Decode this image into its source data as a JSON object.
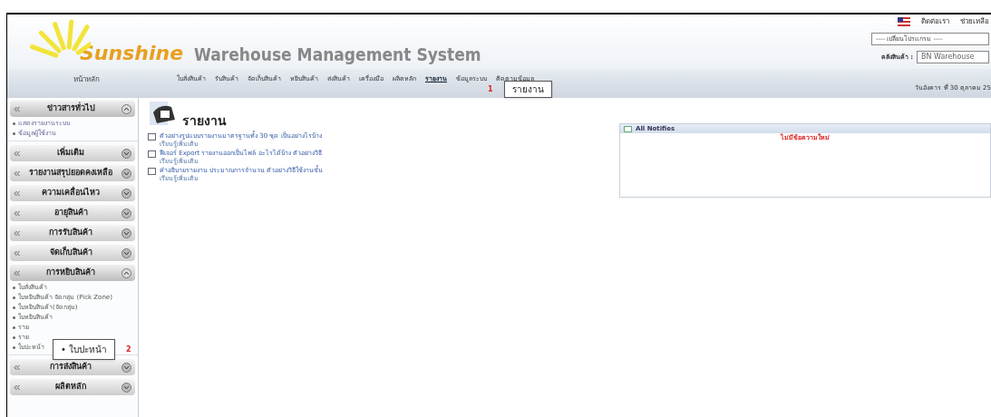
{
  "header": {
    "brand": "Sunshine",
    "title": "Warehouse Management System",
    "links": [
      "ติดต่อเรา",
      "ช่วยเหลือ"
    ],
    "program_select": "---- เปลี่ยนโปรแกรม ----",
    "warehouse_label": "คลังสินค้า :",
    "warehouse_select": "BN Warehouse"
  },
  "nav": {
    "home": "หน้าหลัก",
    "items": [
      {
        "label": "ใบสั่งสินค้า",
        "selected": false
      },
      {
        "label": "รับสินค้า",
        "selected": false
      },
      {
        "label": "จัดเก็บสินค้า",
        "selected": false
      },
      {
        "label": "หยิบสินค้า",
        "selected": false
      },
      {
        "label": "ส่งสินค้า",
        "selected": false
      },
      {
        "label": "เครื่องมือ",
        "selected": false
      },
      {
        "label": "ผลิตหลัก",
        "selected": false
      },
      {
        "label": "รายงาน",
        "selected": true
      },
      {
        "label": "ข้อมูลระบบ",
        "selected": false
      },
      {
        "label": "ติดตามข้อมูล",
        "selected": false
      }
    ],
    "date": "วันอังคาร ที่ 30 ตุลาคม 25"
  },
  "sidebar": {
    "sections": [
      {
        "title": "ข่าวสารทั่วไป",
        "expanded": true,
        "items": [
          "แสดงรายงานระบบ",
          "ข้อมูลผู้ใช้งาน"
        ]
      },
      {
        "title": "เพิ่มเติม",
        "expanded": false
      },
      {
        "title": "รายงานสรุปยอดคงเหลือ",
        "expanded": false
      },
      {
        "title": "ความเคลื่อนไหว",
        "expanded": false
      },
      {
        "title": "อายุสินค้า",
        "expanded": false
      },
      {
        "title": "การรับสินค้า",
        "expanded": false
      },
      {
        "title": "จัดเก็บสินค้า",
        "expanded": false
      },
      {
        "title": "การหยิบสินค้า",
        "expanded": true,
        "items": [
          "ใบสั่งสินค้า",
          "ใบหยิบสินค้า จัดกลุ่ม (Pick Zone)",
          "ใบหยิบสินค้า(จัดกลุ่ม)",
          "ใบหยิบสินค้า",
          "ราย",
          "ราย",
          "ใบปะหน้า"
        ]
      },
      {
        "title": "การส่งสินค้า",
        "expanded": false
      },
      {
        "title": "ผลิตหลัก",
        "expanded": false
      }
    ]
  },
  "page": {
    "title": "รายงาน",
    "links": [
      {
        "text": "ตัวอย่างรูปแบบรายงานมาตรฐานทั้ง 30 ชุด เป็นอย่างไรบ้าง",
        "more": "เรียนรู้เพิ่มเติม"
      },
      {
        "text": "ฟีเจอร์ Export รายงานออกเป็นไฟล์ อะไรได้บ้าง ตัวอย่างวิธี",
        "more": "เรียนรู้เพิ่มเติม"
      },
      {
        "text": "คำอธิบายรายงาน ประมาณการจำนวน ตัวอย่างวิธีใช้งานขั้น",
        "more": "เรียนรู้เพิ่มเติม"
      }
    ]
  },
  "notices": {
    "title": "All Notifies",
    "message": "ไม่มีข้อความใหม่"
  },
  "callouts": [
    {
      "number": "1",
      "text": "รายงาน"
    },
    {
      "number": "2",
      "text": "• ใบปะหน้า"
    }
  ]
}
